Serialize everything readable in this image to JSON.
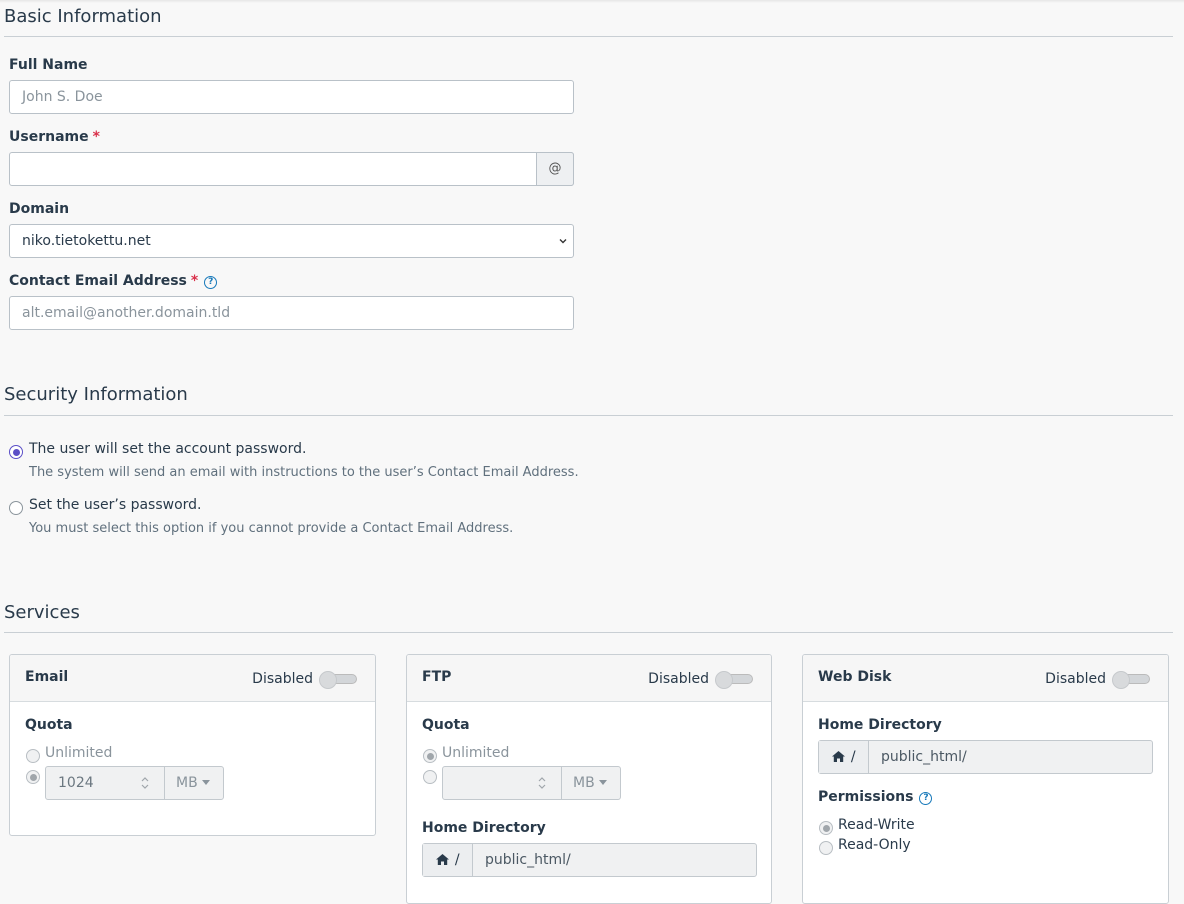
{
  "basic": {
    "title": "Basic Information",
    "full_name_label": "Full Name",
    "full_name_placeholder": "John S. Doe",
    "username_label": "Username",
    "required_mark": "*",
    "username_value": "",
    "at_symbol": "@",
    "domain_label": "Domain",
    "domain_value": "niko.tietokettu.net",
    "email_label": "Contact Email Address",
    "help_mark": "?",
    "email_placeholder": "alt.email@another.domain.tld"
  },
  "security": {
    "title": "Security Information",
    "options": [
      {
        "label": "The user will set the account password.",
        "description": "The system will send an email with instructions to the user’s Contact Email Address.",
        "selected": true
      },
      {
        "label": "Set the user’s password.",
        "description": "You must select this option if you cannot provide a Contact Email Address.",
        "selected": false
      }
    ]
  },
  "services": {
    "title": "Services",
    "email": {
      "title": "Email",
      "status": "Disabled",
      "quota_label": "Quota",
      "unlimited_label": "Unlimited",
      "quota_value": "1024",
      "unit": "MB"
    },
    "ftp": {
      "title": "FTP",
      "status": "Disabled",
      "quota_label": "Quota",
      "unlimited_label": "Unlimited",
      "quota_value": "",
      "unit": "MB",
      "home_dir_label": "Home Directory",
      "home_sep": "/",
      "home_dir_value": "public_html/"
    },
    "webdisk": {
      "title": "Web Disk",
      "status": "Disabled",
      "home_dir_label": "Home Directory",
      "home_sep": "/",
      "home_dir_value": "public_html/",
      "permissions_label": "Permissions",
      "help_mark": "?",
      "perm_rw": "Read-Write",
      "perm_ro": "Read-Only"
    }
  },
  "colors": {
    "accent": "#5b4fc7",
    "required": "#d9304a",
    "help": "#1779ba"
  }
}
